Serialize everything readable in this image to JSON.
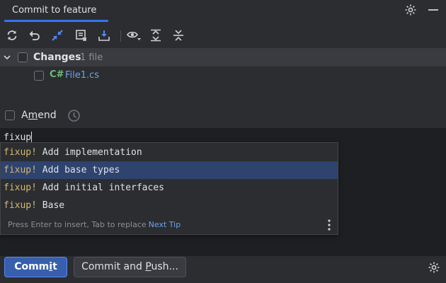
{
  "window": {
    "title": "Commit to feature"
  },
  "toolbar": {
    "icons": [
      "refresh-icon",
      "rollback-icon",
      "merge-arrows-icon",
      "shelve-icon",
      "download-icon",
      "eye-icon",
      "expand-all-icon",
      "collapse-all-icon"
    ]
  },
  "changes": {
    "label": "Changes",
    "count": "1 file"
  },
  "files": [
    {
      "badge": "C#",
      "name": "File1.cs"
    }
  ],
  "amend": {
    "label_pre": "A",
    "label_mnemonic": "m",
    "label_post": "end"
  },
  "editor": {
    "text": "fixup"
  },
  "completion": {
    "items": [
      {
        "keyword": "fixup!",
        "rest": " Add implementation"
      },
      {
        "keyword": "fixup!",
        "rest": " Add base types"
      },
      {
        "keyword": "fixup!",
        "rest": " Add initial interfaces"
      },
      {
        "keyword": "fixup!",
        "rest": " Base"
      }
    ],
    "selected_index": 1,
    "footer": "Press Enter to insert, Tab to replace",
    "next_tip": "Next Tip"
  },
  "buttons": {
    "commit": {
      "pre": "Comm",
      "mnemonic": "i",
      "post": "t"
    },
    "commit_push": {
      "pre": "Commit and ",
      "mnemonic": "P",
      "post": "ush..."
    }
  },
  "colors": {
    "accent": "#3574f0",
    "selection": "#2e436e",
    "keyword": "#d5b778",
    "link": "#6ba3e8",
    "csharp": "#6fbf73"
  }
}
